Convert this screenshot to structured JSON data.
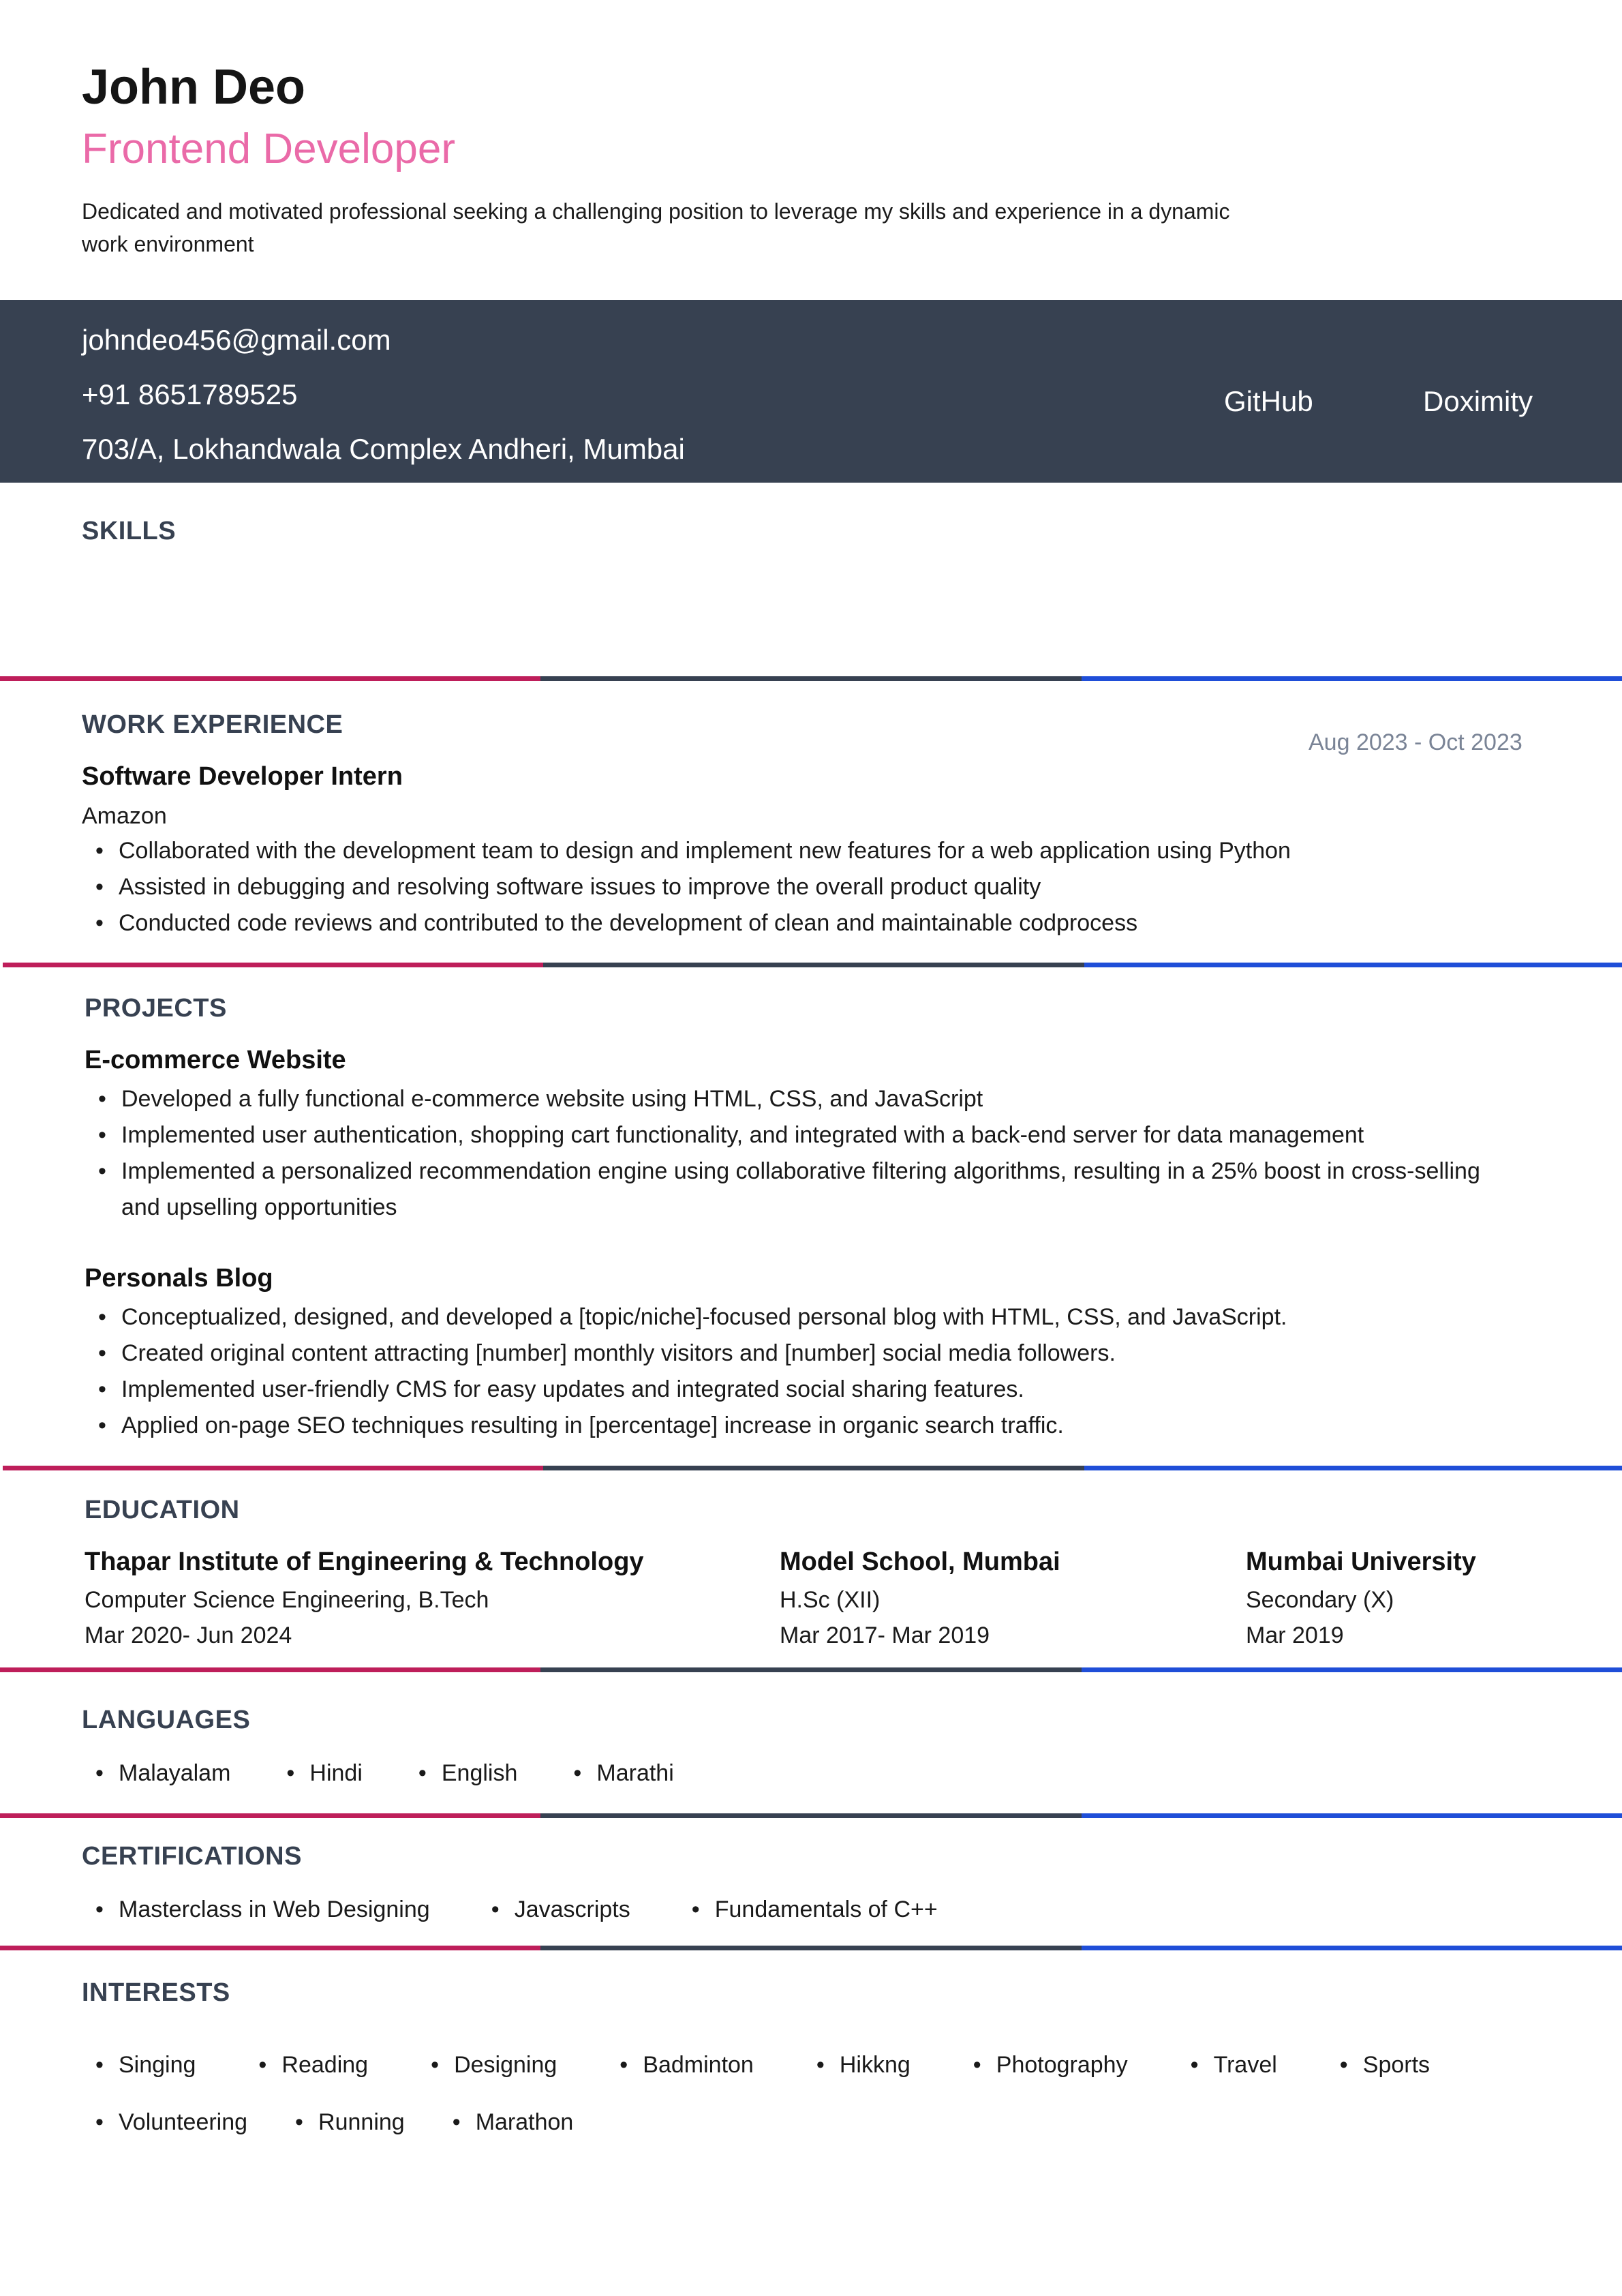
{
  "header": {
    "name": "John Deo",
    "role": "Frontend Developer",
    "summary": "Dedicated and motivated professional seeking a challenging position to leverage my skills and experience in a dynamic work environment"
  },
  "contact": {
    "email": "johndeo456@gmail.com",
    "phone": "+91 8651789525",
    "address": "703/A, Lokhandwala Complex Andheri, Mumbai",
    "links": [
      "GitHub",
      "Doximity"
    ]
  },
  "skills": {
    "heading": "SKILLS"
  },
  "work": {
    "heading": "WORK EXPERIENCE",
    "jobs": [
      {
        "title": "Software Developer Intern",
        "company": "Amazon",
        "dates": "Aug 2023 - Oct 2023",
        "bullets": [
          "Collaborated with the development team to design and implement new features for a web application using Python",
          "Assisted in debugging and resolving software issues to improve the overall product quality",
          "Conducted code reviews and contributed to the development of clean and maintainable codprocess"
        ]
      }
    ]
  },
  "projects": {
    "heading": "PROJECTS",
    "items": [
      {
        "title": "E-commerce Website",
        "bullets": [
          "Developed a fully functional e-commerce website using HTML, CSS, and JavaScript",
          "Implemented user authentication, shopping cart functionality, and integrated with a back-end server for data management",
          "Implemented a personalized recommendation engine using collaborative filtering algorithms, resulting in a 25% boost in cross-selling and upselling opportunities"
        ]
      },
      {
        "title": "Personals Blog",
        "bullets": [
          "Conceptualized, designed, and developed a [topic/niche]-focused personal blog with HTML, CSS, and JavaScript.",
          "Created original content attracting [number] monthly visitors and [number] social media followers.",
          "Implemented user-friendly CMS for easy updates and integrated social sharing features.",
          "Applied on-page SEO techniques resulting in [percentage] increase in organic search traffic."
        ]
      }
    ]
  },
  "education": {
    "heading": "EDUCATION",
    "items": [
      {
        "school": "Thapar Institute of Engineering & Technology",
        "degree": "Computer Science Engineering, B.Tech",
        "dates": "Mar 2020- Jun 2024"
      },
      {
        "school": "Model School, Mumbai",
        "degree": "H.Sc (XII)",
        "dates": "Mar 2017- Mar 2019"
      },
      {
        "school": "Mumbai University",
        "degree": "Secondary (X)",
        "dates": "Mar 2019"
      }
    ]
  },
  "languages": {
    "heading": "LANGUAGES",
    "items": [
      "Malayalam",
      "Hindi",
      "English",
      "Marathi"
    ]
  },
  "certifications": {
    "heading": "CERTIFICATIONS",
    "items": [
      "Masterclass in Web Designing",
      "Javascripts",
      "Fundamentals of C++"
    ]
  },
  "interests": {
    "heading": "INTERESTS",
    "items": [
      "Singing",
      "Reading",
      "Designing",
      "Badminton",
      "Hikkng",
      "Photography",
      "Travel",
      "Sports",
      "Volunteering",
      "Running",
      "Marathon"
    ]
  },
  "colors": {
    "accent_pink": "#ea6aa8",
    "band": "#374151",
    "divider_red": "#be1e5a",
    "divider_blue": "#1f4ed8"
  }
}
